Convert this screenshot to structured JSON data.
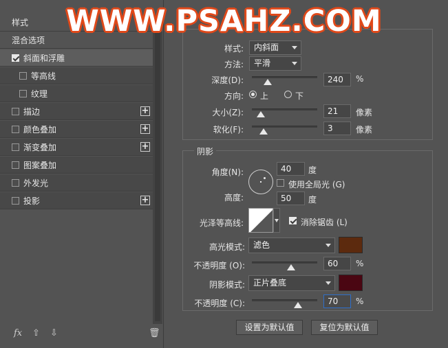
{
  "left_panel": {
    "header": "样式",
    "items": [
      {
        "label": "混合选项",
        "checkbox": false,
        "checked": false,
        "plus": false
      },
      {
        "label": "斜面和浮雕",
        "checkbox": true,
        "checked": true,
        "plus": false,
        "selected": true
      },
      {
        "label": "等高线",
        "checkbox": true,
        "checked": false,
        "plus": false,
        "sub": true
      },
      {
        "label": "纹理",
        "checkbox": true,
        "checked": false,
        "plus": false,
        "sub": true
      },
      {
        "label": "描边",
        "checkbox": true,
        "checked": false,
        "plus": true
      },
      {
        "label": "颜色叠加",
        "checkbox": true,
        "checked": false,
        "plus": true
      },
      {
        "label": "渐变叠加",
        "checkbox": true,
        "checked": false,
        "plus": true
      },
      {
        "label": "图案叠加",
        "checkbox": true,
        "checked": false,
        "plus": false
      },
      {
        "label": "外发光",
        "checkbox": true,
        "checked": false,
        "plus": false
      },
      {
        "label": "投影",
        "checkbox": true,
        "checked": false,
        "plus": true
      }
    ],
    "bottom": {
      "fx": "fx"
    }
  },
  "structure": {
    "style_label": "样式:",
    "style_value": "内斜面",
    "method_label": "方法:",
    "method_value": "平滑",
    "depth_label": "深度(D):",
    "depth_value": "240",
    "depth_unit": "%",
    "depth_level": 0.24,
    "direction_label": "方向:",
    "direction_up": "上",
    "direction_down": "下",
    "size_label": "大小(Z):",
    "size_value": "21",
    "size_unit": "像素",
    "size_level": 0.14,
    "soften_label": "软化(F):",
    "soften_value": "3",
    "soften_unit": "像素",
    "soften_level": 0.18
  },
  "shading": {
    "title": "阴影",
    "angle_label": "角度(N):",
    "angle_value": "40",
    "angle_unit": "度",
    "global_light_label": "使用全局光 (G)",
    "altitude_label": "高度:",
    "altitude_value": "50",
    "altitude_unit": "度",
    "gloss_label": "光泽等高线:",
    "antialias_label": "消除锯齿 (L)",
    "highlight_mode_label": "高光模式:",
    "highlight_mode_value": "滤色",
    "highlight_color": "#5c2a0e",
    "highlight_opacity_label": "不透明度 (O):",
    "highlight_opacity_value": "60",
    "highlight_opacity_unit": "%",
    "highlight_opacity_level": 0.6,
    "shadow_mode_label": "阴影模式:",
    "shadow_mode_value": "正片叠底",
    "shadow_color": "#4a0612",
    "shadow_opacity_label": "不透明度 (C):",
    "shadow_opacity_value": "70",
    "shadow_opacity_unit": "%",
    "shadow_opacity_level": 0.7
  },
  "buttons": {
    "make_default": "设置为默认值",
    "reset_default": "复位为默认值"
  },
  "watermark": "WWW.PSAHZ.COM"
}
